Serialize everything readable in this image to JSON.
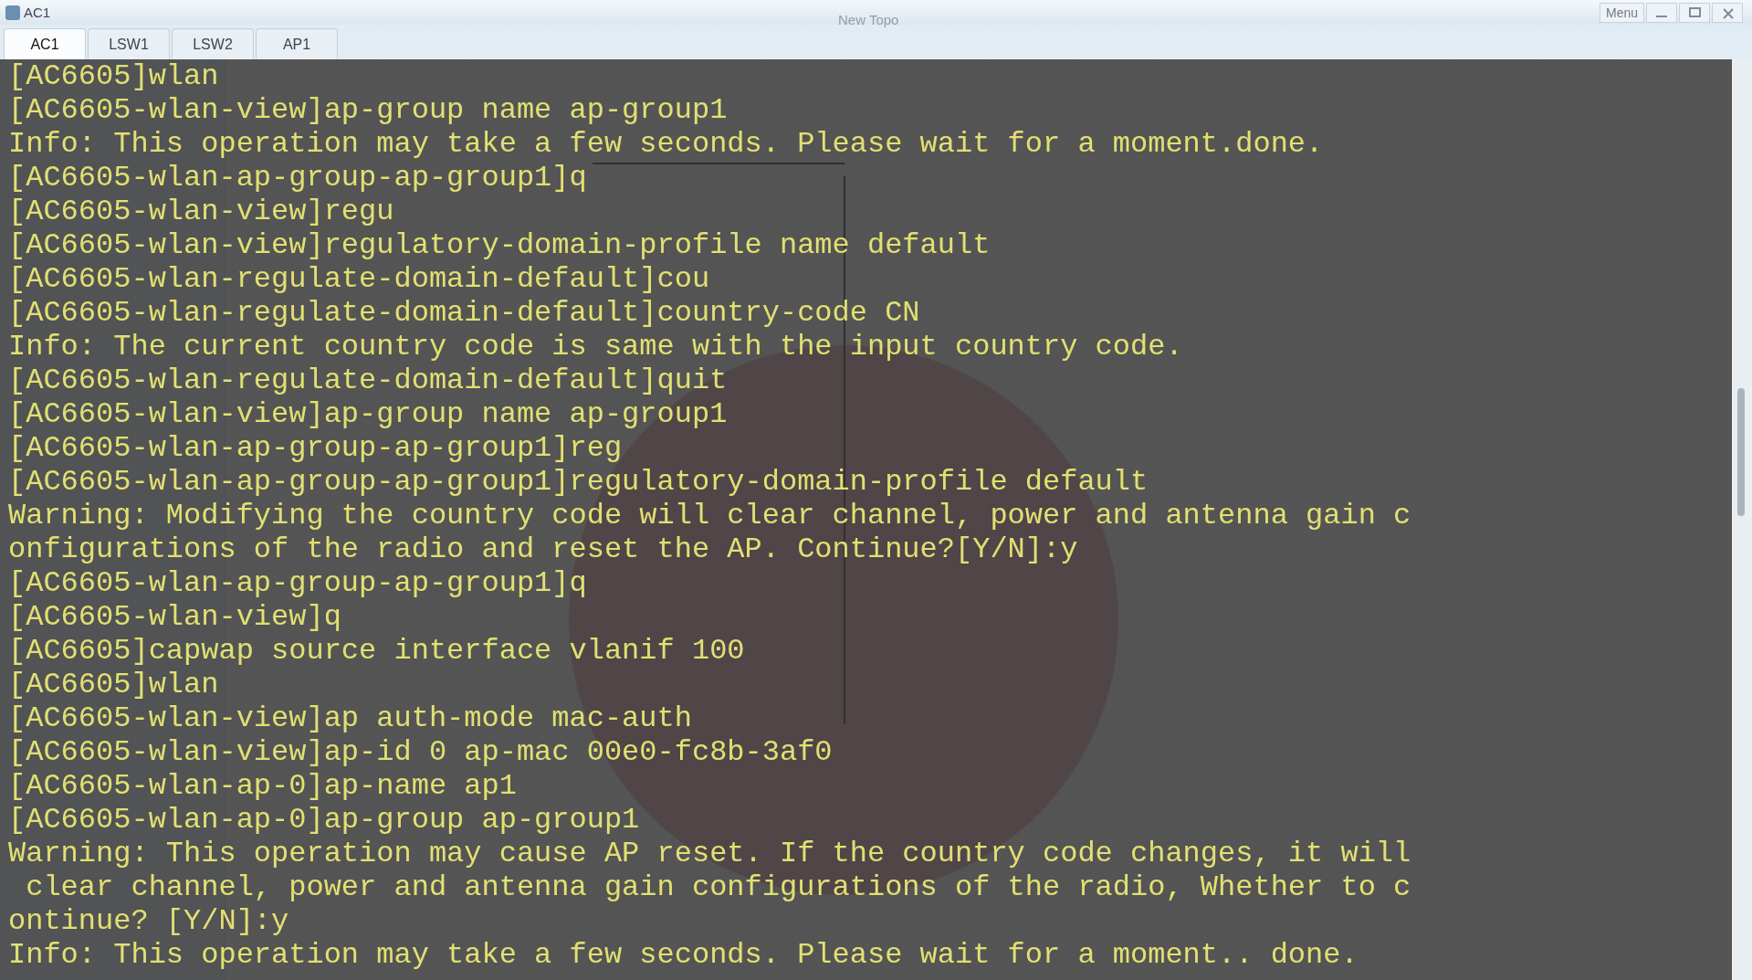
{
  "window": {
    "title": "AC1",
    "app_title": "New Topo",
    "menu": "Menu"
  },
  "tabs": [
    {
      "label": "AC1",
      "selected": true
    },
    {
      "label": "LSW1",
      "selected": false
    },
    {
      "label": "LSW2",
      "selected": false
    },
    {
      "label": "AP1",
      "selected": false
    }
  ],
  "terminal": {
    "lines": [
      "[AC6605]wlan",
      "[AC6605-wlan-view]ap-group name ap-group1",
      "Info: This operation may take a few seconds. Please wait for a moment.done.",
      "[AC6605-wlan-ap-group-ap-group1]q",
      "[AC6605-wlan-view]regu",
      "[AC6605-wlan-view]regulatory-domain-profile name default",
      "[AC6605-wlan-regulate-domain-default]cou",
      "[AC6605-wlan-regulate-domain-default]country-code CN",
      "Info: The current country code is same with the input country code.",
      "[AC6605-wlan-regulate-domain-default]quit",
      "[AC6605-wlan-view]ap-group name ap-group1",
      "[AC6605-wlan-ap-group-ap-group1]reg",
      "[AC6605-wlan-ap-group-ap-group1]regulatory-domain-profile default",
      "Warning: Modifying the country code will clear channel, power and antenna gain c",
      "onfigurations of the radio and reset the AP. Continue?[Y/N]:y",
      "[AC6605-wlan-ap-group-ap-group1]q",
      "[AC6605-wlan-view]q",
      "[AC6605]capwap source interface vlanif 100",
      "[AC6605]wlan",
      "[AC6605-wlan-view]ap auth-mode mac-auth",
      "[AC6605-wlan-view]ap-id 0 ap-mac 00e0-fc8b-3af0",
      "[AC6605-wlan-ap-0]ap-name ap1",
      "[AC6605-wlan-ap-0]ap-group ap-group1",
      "Warning: This operation may cause AP reset. If the country code changes, it will",
      " clear channel, power and antenna gain configurations of the radio, Whether to c",
      "ontinue? [Y/N]:y",
      "Info: This operation may take a few seconds. Please wait for a moment.. done."
    ]
  }
}
